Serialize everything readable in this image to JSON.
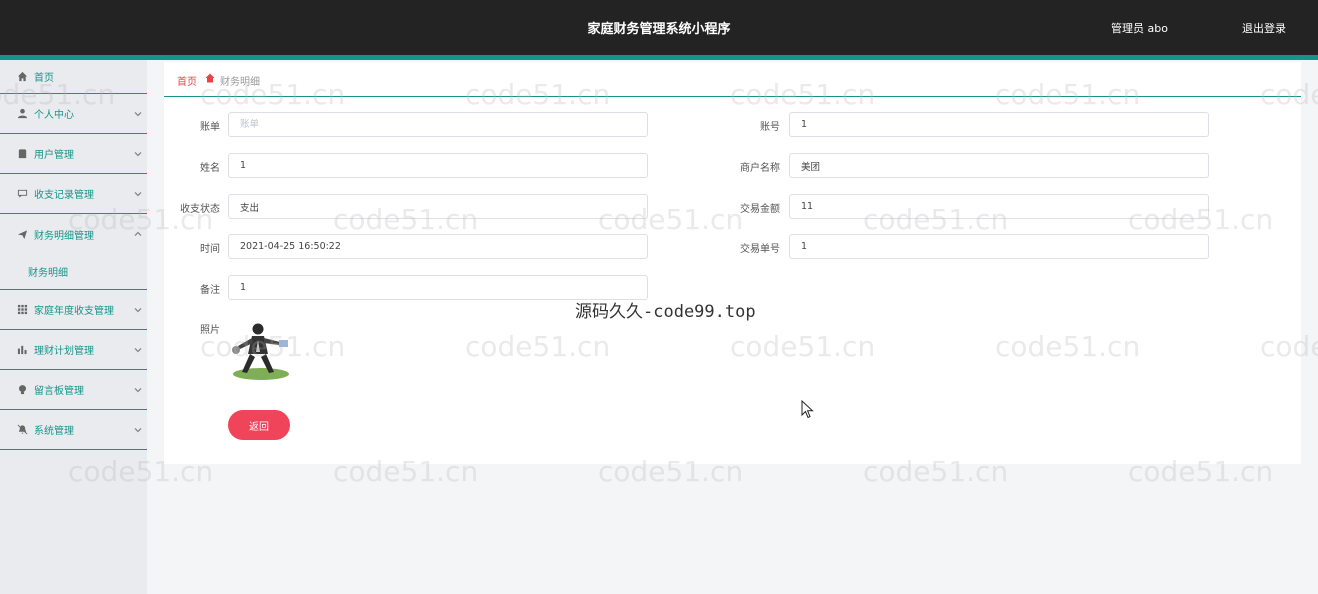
{
  "header": {
    "title": "家庭财务管理系统小程序",
    "user": "管理员 abo",
    "logout": "退出登录"
  },
  "sidebar": {
    "items": [
      {
        "label": "首页",
        "icon": "home-icon"
      },
      {
        "label": "个人中心",
        "icon": "person-icon"
      },
      {
        "label": "用户管理",
        "icon": "clipboard-icon"
      },
      {
        "label": "收支记录管理",
        "icon": "chat-icon"
      },
      {
        "label": "财务明细管理",
        "icon": "send-icon"
      },
      {
        "label": "家庭年度收支管理",
        "icon": "grid-icon"
      },
      {
        "label": "理财计划管理",
        "icon": "bar-chart-icon"
      },
      {
        "label": "留言板管理",
        "icon": "bulb-icon"
      },
      {
        "label": "系统管理",
        "icon": "bell-off-icon"
      }
    ],
    "sub_item": "财务明细"
  },
  "breadcrumb": {
    "home": "首页",
    "current": "财务明细"
  },
  "form": {
    "bill": {
      "label": "账单",
      "placeholder": "账单",
      "value": ""
    },
    "account": {
      "label": "账号",
      "value": "1"
    },
    "name": {
      "label": "姓名",
      "value": "1"
    },
    "merchant": {
      "label": "商户名称",
      "value": "美团"
    },
    "status": {
      "label": "收支状态",
      "value": "支出"
    },
    "amount": {
      "label": "交易金额",
      "value": "11"
    },
    "time": {
      "label": "时间",
      "value": "2021-04-25 16:50:22"
    },
    "order_no": {
      "label": "交易单号",
      "value": "1"
    },
    "remark": {
      "label": "备注",
      "value": "1"
    },
    "photo": {
      "label": "照片"
    }
  },
  "buttons": {
    "back": "返回"
  },
  "watermark": {
    "text": "code51.cn",
    "center": "源码久久-code99.top"
  },
  "colors": {
    "header_bg": "#232323",
    "accent": "#17948a",
    "breadcrumb_red": "#e34646",
    "button_red": "#f0445b"
  }
}
